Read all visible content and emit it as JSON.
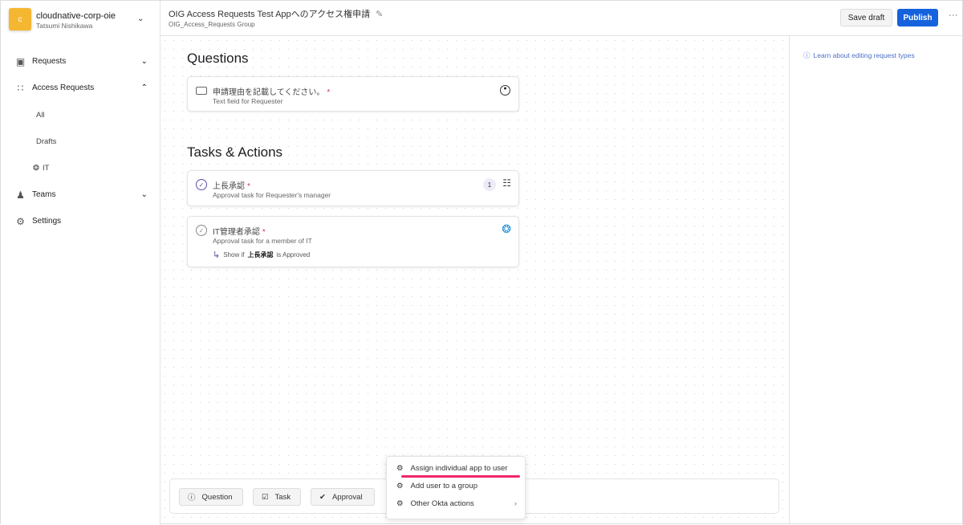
{
  "org": {
    "initial": "c",
    "name": "cloudnative-corp-oie",
    "user": "Tatsumi Nishikawa"
  },
  "sidebar": {
    "items": [
      {
        "label": "Requests"
      },
      {
        "label": "Access Requests"
      },
      {
        "label": "Teams"
      },
      {
        "label": "Settings"
      }
    ],
    "sub": [
      {
        "label": "All"
      },
      {
        "label": "Drafts"
      },
      {
        "label": "IT"
      }
    ]
  },
  "header": {
    "title": "OIG Access Requests Test Appへのアクセス権申請",
    "subtitle": "OIG_Access_Requests Group",
    "save_label": "Save draft",
    "publish_label": "Publish"
  },
  "right": {
    "learn_link": "Learn about editing request types"
  },
  "questions": {
    "heading": "Questions",
    "items": [
      {
        "title": "申請理由を記載してください。",
        "required": "*",
        "desc": "Text field for Requester"
      }
    ]
  },
  "tasks": {
    "heading": "Tasks & Actions",
    "items": [
      {
        "title": "上長承認",
        "required": "*",
        "desc": "Approval task for Requester's manager",
        "badge": "1"
      },
      {
        "title": "IT管理者承認",
        "required": "*",
        "desc": "Approval task for a member of IT",
        "cond_prefix": "Show if",
        "cond_task": "上長承認",
        "cond_suffix": "is Approved"
      }
    ]
  },
  "toolbar": {
    "question": "Question",
    "task": "Task",
    "approval": "Approval"
  },
  "menu": {
    "items": [
      {
        "label": "Assign individual app to user"
      },
      {
        "label": "Add user to a group"
      },
      {
        "label": "Other Okta actions"
      }
    ]
  },
  "colors": {
    "accent": "#1662dd",
    "highlight": "#f0256b",
    "org": "#f5b731"
  }
}
